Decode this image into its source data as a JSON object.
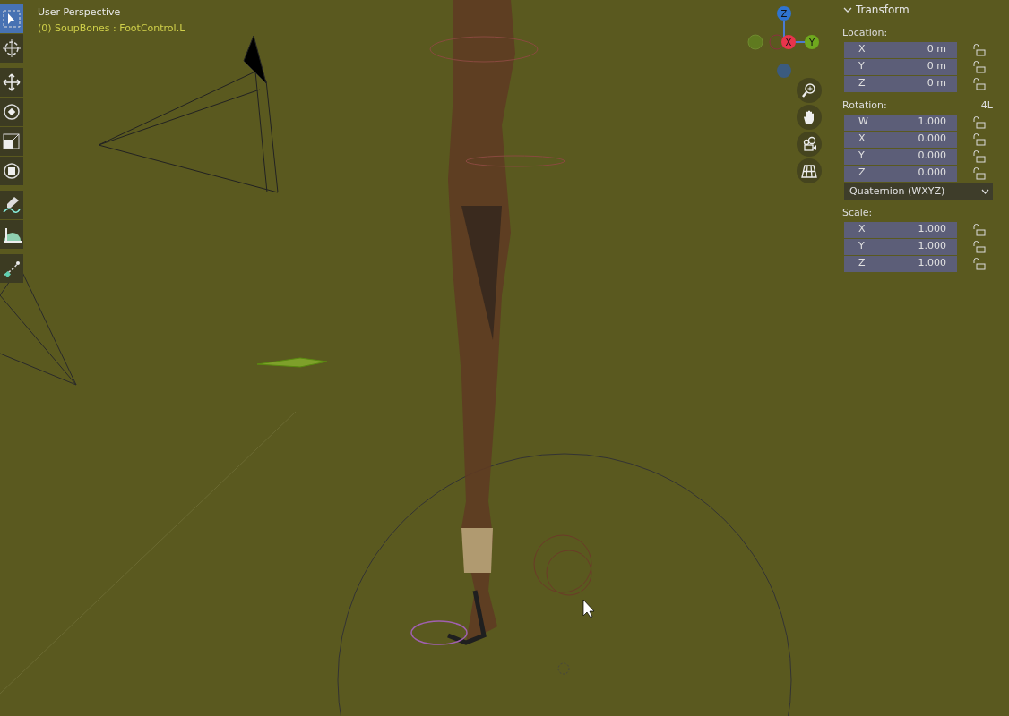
{
  "viewport": {
    "title": "User Perspective",
    "context": "(0) SoupBones : FootControl.L"
  },
  "toolbar": [
    {
      "kind": "select",
      "selected": true
    },
    {
      "kind": "cursor",
      "selected": false
    },
    {
      "kind": "move",
      "selected": false
    },
    {
      "kind": "rotate",
      "selected": false
    },
    {
      "kind": "scale",
      "selected": false
    },
    {
      "kind": "transform",
      "selected": false
    },
    {
      "kind": "annotate",
      "selected": false
    },
    {
      "kind": "measure",
      "selected": false
    },
    {
      "kind": "bone",
      "selected": false
    }
  ],
  "gizmo": {
    "z": "Z",
    "x": "X",
    "y": "Y"
  },
  "transform_panel": {
    "title": "Transform",
    "expanded": true,
    "location": {
      "label": "Location:",
      "fields": [
        {
          "axis": "X",
          "value": "0 m",
          "locked": false
        },
        {
          "axis": "Y",
          "value": "0 m",
          "locked": false
        },
        {
          "axis": "Z",
          "value": "0 m",
          "locked": false
        }
      ]
    },
    "rotation": {
      "label": "Rotation:",
      "badge": "4L",
      "fields": [
        {
          "axis": "W",
          "value": "1.000",
          "locked": false
        },
        {
          "axis": "X",
          "value": "0.000",
          "locked": false
        },
        {
          "axis": "Y",
          "value": "0.000",
          "locked": false
        },
        {
          "axis": "Z",
          "value": "0.000",
          "locked": false
        }
      ]
    },
    "rotation_mode": "Quaternion (WXYZ)",
    "scale": {
      "label": "Scale:",
      "fields": [
        {
          "axis": "X",
          "value": "1.000",
          "locked": false
        },
        {
          "axis": "Y",
          "value": "1.000",
          "locked": false
        },
        {
          "axis": "Z",
          "value": "1.000",
          "locked": false
        }
      ]
    }
  }
}
